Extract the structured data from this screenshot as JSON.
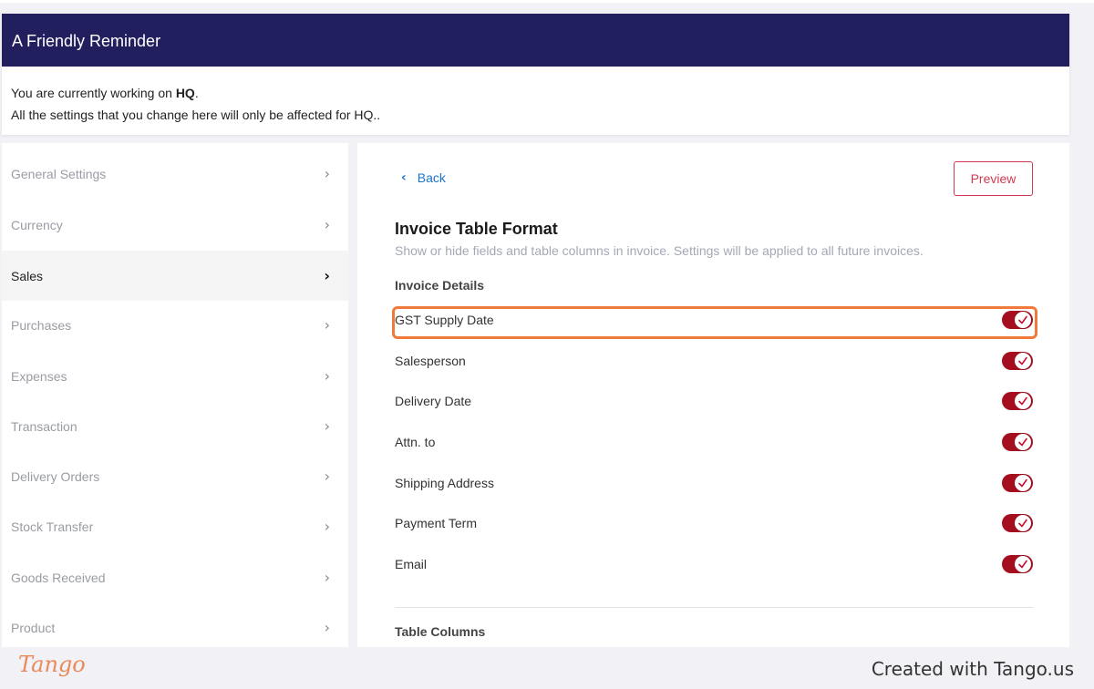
{
  "reminder": {
    "title": "A Friendly Reminder",
    "line1_prefix": "You are currently working on ",
    "line1_location": "HQ",
    "line1_suffix": ".",
    "line2": "All the settings that you change here will only be affected for HQ.."
  },
  "sidebar": {
    "items": [
      {
        "label": "General Settings",
        "active": false
      },
      {
        "label": "Currency",
        "active": false
      },
      {
        "label": "Sales",
        "active": true
      },
      {
        "label": "Purchases",
        "active": false
      },
      {
        "label": "Expenses",
        "active": false
      },
      {
        "label": "Transaction",
        "active": false
      },
      {
        "label": "Delivery Orders",
        "active": false
      },
      {
        "label": "Stock Transfer",
        "active": false
      },
      {
        "label": "Goods Received",
        "active": false
      },
      {
        "label": "Product",
        "active": false
      }
    ]
  },
  "main": {
    "back_label": "Back",
    "preview_label": "Preview",
    "title": "Invoice Table Format",
    "subtitle": "Show or hide fields and table columns in invoice. Settings will be applied to all future invoices.",
    "invoice_details_heading": "Invoice Details",
    "invoice_details": [
      {
        "label": "GST Supply Date",
        "enabled": true
      },
      {
        "label": "Salesperson",
        "enabled": true
      },
      {
        "label": "Delivery Date",
        "enabled": true
      },
      {
        "label": "Attn. to",
        "enabled": true
      },
      {
        "label": "Shipping Address",
        "enabled": true
      },
      {
        "label": "Payment Term",
        "enabled": true
      },
      {
        "label": "Email",
        "enabled": true
      }
    ],
    "table_columns_heading": "Table Columns"
  },
  "footer": {
    "logo_text": "Tango",
    "created_text": "Created with Tango.us"
  },
  "colors": {
    "header_bg": "#211f5e",
    "toggle_on": "#a50e1e",
    "highlight": "#f07a3a",
    "link": "#1a73c7",
    "preview_border": "#d23a52"
  }
}
